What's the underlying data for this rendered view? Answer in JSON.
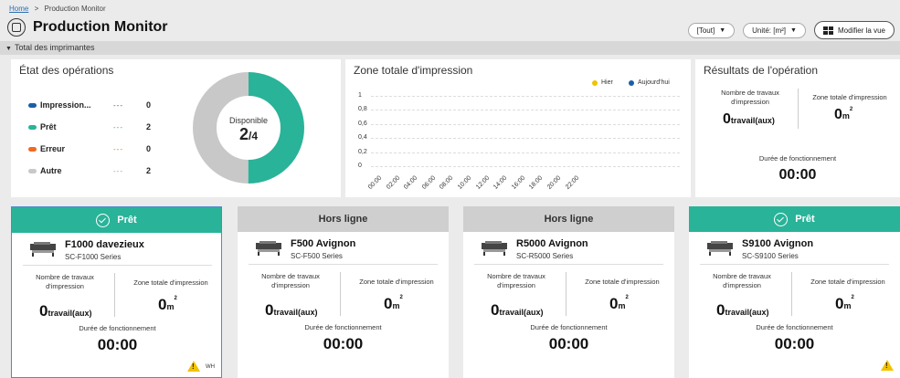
{
  "breadcrumb": {
    "home": "Home",
    "separator": ">",
    "current": "Production Monitor"
  },
  "page": {
    "title": "Production Monitor"
  },
  "controls": {
    "filter": "[Tout]",
    "unit": "Unité: [m²]",
    "modify": "Modifier la vue"
  },
  "section": {
    "label": "Total des imprimantes"
  },
  "operations": {
    "title": "État des opérations",
    "items": [
      {
        "label": "Impression...",
        "dashes": "---",
        "value": "0",
        "color": "#1a5fa8"
      },
      {
        "label": "Prêt",
        "dashes": "---",
        "value": "2",
        "color": "#29b399"
      },
      {
        "label": "Erreur",
        "dashes": "---",
        "value": "0",
        "color": "#f06a22"
      },
      {
        "label": "Autre",
        "dashes": "---",
        "value": "2",
        "color": "#c8c8c8"
      }
    ],
    "donut_label": "Disponible",
    "donut_num": "2",
    "donut_den": "/4"
  },
  "chart_data": {
    "type": "line",
    "title": "Zone totale d'impression",
    "x": [
      "00:00",
      "02:00",
      "04:00",
      "06:00",
      "08:00",
      "10:00",
      "12:00",
      "14:00",
      "16:00",
      "18:00",
      "20:00",
      "22:00"
    ],
    "yticks": [
      "1",
      "0,8",
      "0,6",
      "0,4",
      "0,2",
      "0"
    ],
    "ylim": [
      0,
      1
    ],
    "series": [
      {
        "name": "Hier",
        "color": "#f2c200",
        "values": [
          0,
          0,
          0,
          0,
          0,
          0,
          0,
          0,
          0,
          0,
          0,
          0
        ]
      },
      {
        "name": "Aujourd'hui",
        "color": "#1a5fa8",
        "values": [
          0,
          0,
          0,
          0,
          0,
          0,
          0,
          0,
          0,
          0,
          0,
          0
        ]
      }
    ],
    "legend": "top-right",
    "grid": true
  },
  "results": {
    "title": "Résultats de l'opération",
    "jobs_label": "Nombre de travaux d'impression",
    "area_label": "Zone totale d'impression",
    "jobs_value": "0",
    "jobs_unit": "travail(aux)",
    "area_value": "0",
    "area_unit": "m",
    "area_exp": "2",
    "duration_label": "Durée de fonctionnement",
    "duration": "00:00"
  },
  "printers": [
    {
      "status": "Prêt",
      "name": "F1000 davezieux",
      "model": "SC-F1000 Series",
      "jobs_label": "Nombre de travaux d'impression",
      "area_label": "Zone totale d'impression",
      "jobs": "0",
      "jobs_unit": "travail(aux)",
      "area": "0",
      "area_unit": "m",
      "area_exp": "2",
      "dur_label": "Durée de fonctionnement",
      "dur": "00:00",
      "warn_text": "WH"
    },
    {
      "status": "Hors ligne",
      "name": "F500 Avignon",
      "model": "SC-F500 Series",
      "jobs_label": "Nombre de travaux d'impression",
      "area_label": "Zone totale d'impression",
      "jobs": "0",
      "jobs_unit": "travail(aux)",
      "area": "0",
      "area_unit": "m",
      "area_exp": "2",
      "dur_label": "Durée de fonctionnement",
      "dur": "00:00"
    },
    {
      "status": "Hors ligne",
      "name": "R5000 Avignon",
      "model": "SC-R5000 Series",
      "jobs_label": "Nombre de travaux d'impression",
      "area_label": "Zone totale d'impression",
      "jobs": "0",
      "jobs_unit": "travail(aux)",
      "area": "0",
      "area_unit": "m",
      "area_exp": "2",
      "dur_label": "Durée de fonctionnement",
      "dur": "00:00"
    },
    {
      "status": "Prêt",
      "name": "S9100 Avignon",
      "model": "SC-S9100 Series",
      "jobs_label": "Nombre de travaux d'impression",
      "area_label": "Zone totale d'impression",
      "jobs": "0",
      "jobs_unit": "travail(aux)",
      "area": "0",
      "area_unit": "m",
      "area_exp": "2",
      "dur_label": "Durée de fonctionnement",
      "dur": "00:00"
    }
  ]
}
